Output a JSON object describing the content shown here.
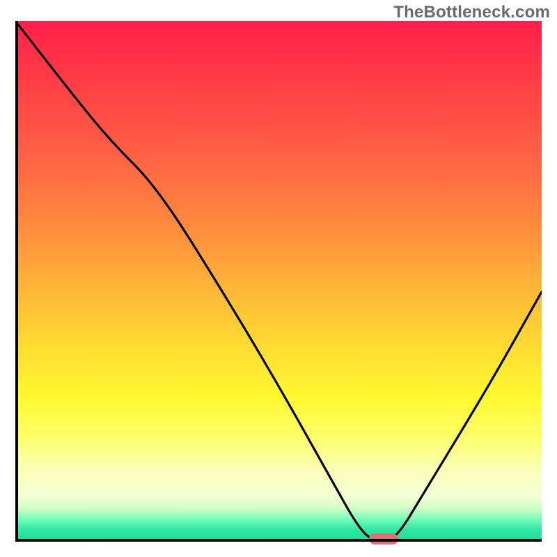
{
  "watermark": "TheBottleneck.com",
  "chart_data": {
    "type": "line",
    "title": "",
    "xlabel": "",
    "ylabel": "",
    "xlim": [
      0,
      100
    ],
    "ylim": [
      0,
      100
    ],
    "grid": false,
    "background": "rainbow-gradient-red-to-green",
    "series": [
      {
        "name": "bottleneck-curve",
        "color": "#000000",
        "x": [
          0,
          10,
          18,
          27,
          40,
          50,
          60,
          65,
          68,
          72,
          78,
          90,
          100
        ],
        "y": [
          100,
          87,
          77,
          68,
          47,
          30,
          12,
          3,
          0,
          0,
          10,
          30,
          48
        ]
      }
    ],
    "marker": {
      "x_center": 70,
      "y": 0,
      "color": "#e07171",
      "shape": "pill"
    },
    "legend": false
  },
  "colors": {
    "axis": "#000000",
    "watermark": "#6a6a6a",
    "marker": "#e07171"
  }
}
